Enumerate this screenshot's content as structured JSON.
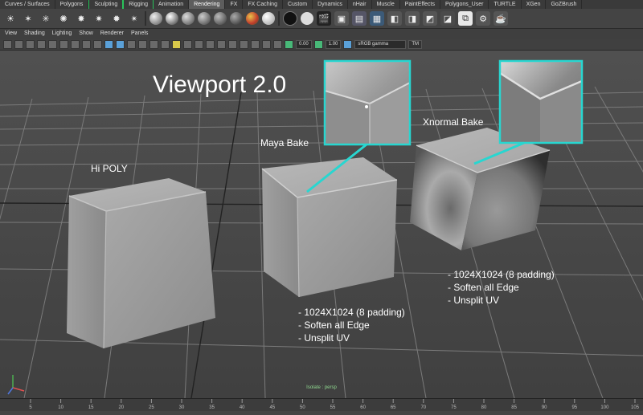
{
  "shelf_tabs": [
    "Curves / Surfaces",
    "Polygons",
    "Sculpting",
    "Rigging",
    "Animation",
    "Rendering",
    "FX",
    "FX Caching",
    "Custom",
    "Dynamics",
    "nHair",
    "Muscle",
    "PaintEffects",
    "Polygons_User",
    "TURTLE",
    "XGen",
    "GoZBrush"
  ],
  "active_tab": "Rendering",
  "panel_menu": [
    "View",
    "Shading",
    "Lighting",
    "Show",
    "Renderer",
    "Panels"
  ],
  "toolbar": {
    "exposure": "0.00",
    "gamma": "1.00",
    "colorspace": "sRGB gamma",
    "tm_badge": "TM"
  },
  "viewport": {
    "title": "Viewport 2.0",
    "labels": {
      "hipoly": "Hi POLY",
      "maya_bake": "Maya Bake",
      "xnormal_bake": "Xnormal Bake"
    },
    "maya_notes": [
      "- 1024X1024 (8 padding)",
      "- Soften all Edge",
      "- Unsplit UV"
    ],
    "xnormal_notes": [
      "- 1024X1024 (8 padding)",
      "- Soften all Edge",
      "- Unsplit UV"
    ],
    "camera_label": "Isolate : persp",
    "callout_color": "#28d6d0"
  },
  "timeline_ticks": [
    "5",
    "10",
    "15",
    "20",
    "25",
    "30",
    "35",
    "40",
    "45",
    "50",
    "55",
    "60",
    "65",
    "70",
    "75",
    "80",
    "85",
    "90",
    "95",
    "100",
    "105"
  ]
}
